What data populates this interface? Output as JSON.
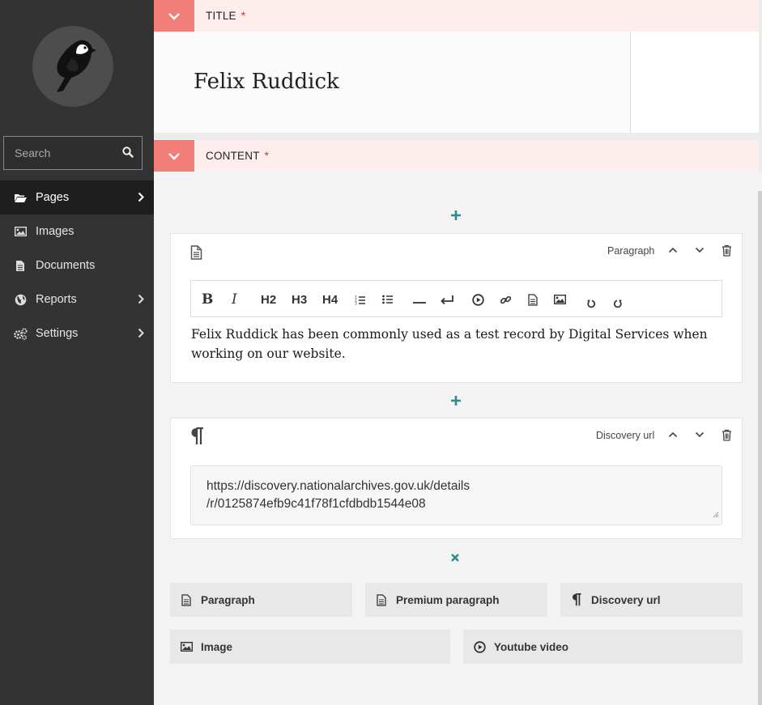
{
  "sidebar": {
    "search": {
      "placeholder": "Search"
    },
    "items": [
      {
        "label": "Pages",
        "icon": "folder-open-icon",
        "active": true,
        "has_chevron": true
      },
      {
        "label": "Images",
        "icon": "image-icon",
        "active": false,
        "has_chevron": false
      },
      {
        "label": "Documents",
        "icon": "document-icon",
        "active": false,
        "has_chevron": false
      },
      {
        "label": "Reports",
        "icon": "globe-icon",
        "active": false,
        "has_chevron": true
      },
      {
        "label": "Settings",
        "icon": "cogs-icon",
        "active": false,
        "has_chevron": true
      }
    ]
  },
  "title_panel": {
    "label": "TITLE",
    "required_marker": "*",
    "value": "Felix Ruddick"
  },
  "content_panel": {
    "label": "CONTENT",
    "required_marker": "*"
  },
  "blocks": [
    {
      "type_label": "Paragraph",
      "toolbar": [
        "B",
        "I",
        "H2",
        "H3",
        "H4",
        "ordered-list",
        "bulleted-list",
        "horizontal-line",
        "line-break",
        "embed",
        "link",
        "document-link",
        "image",
        "undo",
        "redo"
      ],
      "text": "Felix Ruddick has been commonly used as a test record by Digital Services when working on our website."
    },
    {
      "type_label": "Discovery url",
      "value": "https://discovery.nationalarchives.gov.uk/details\n/r/0125874efb9c41f78f1cfdbdb1544e08"
    }
  ],
  "chooser": {
    "items": [
      {
        "label": "Paragraph",
        "icon": "document-icon"
      },
      {
        "label": "Premium paragraph",
        "icon": "document-icon"
      },
      {
        "label": "Discovery url",
        "icon": "pilcrow-icon"
      },
      {
        "label": "Image",
        "icon": "image-icon"
      },
      {
        "label": "Youtube video",
        "icon": "play-icon"
      }
    ]
  },
  "colors": {
    "sidebar_bg": "#333333",
    "panel_header_bg": "#fdeeed",
    "panel_toggle_bg": "#f37e77",
    "teal_accent": "#2e8b8b"
  }
}
